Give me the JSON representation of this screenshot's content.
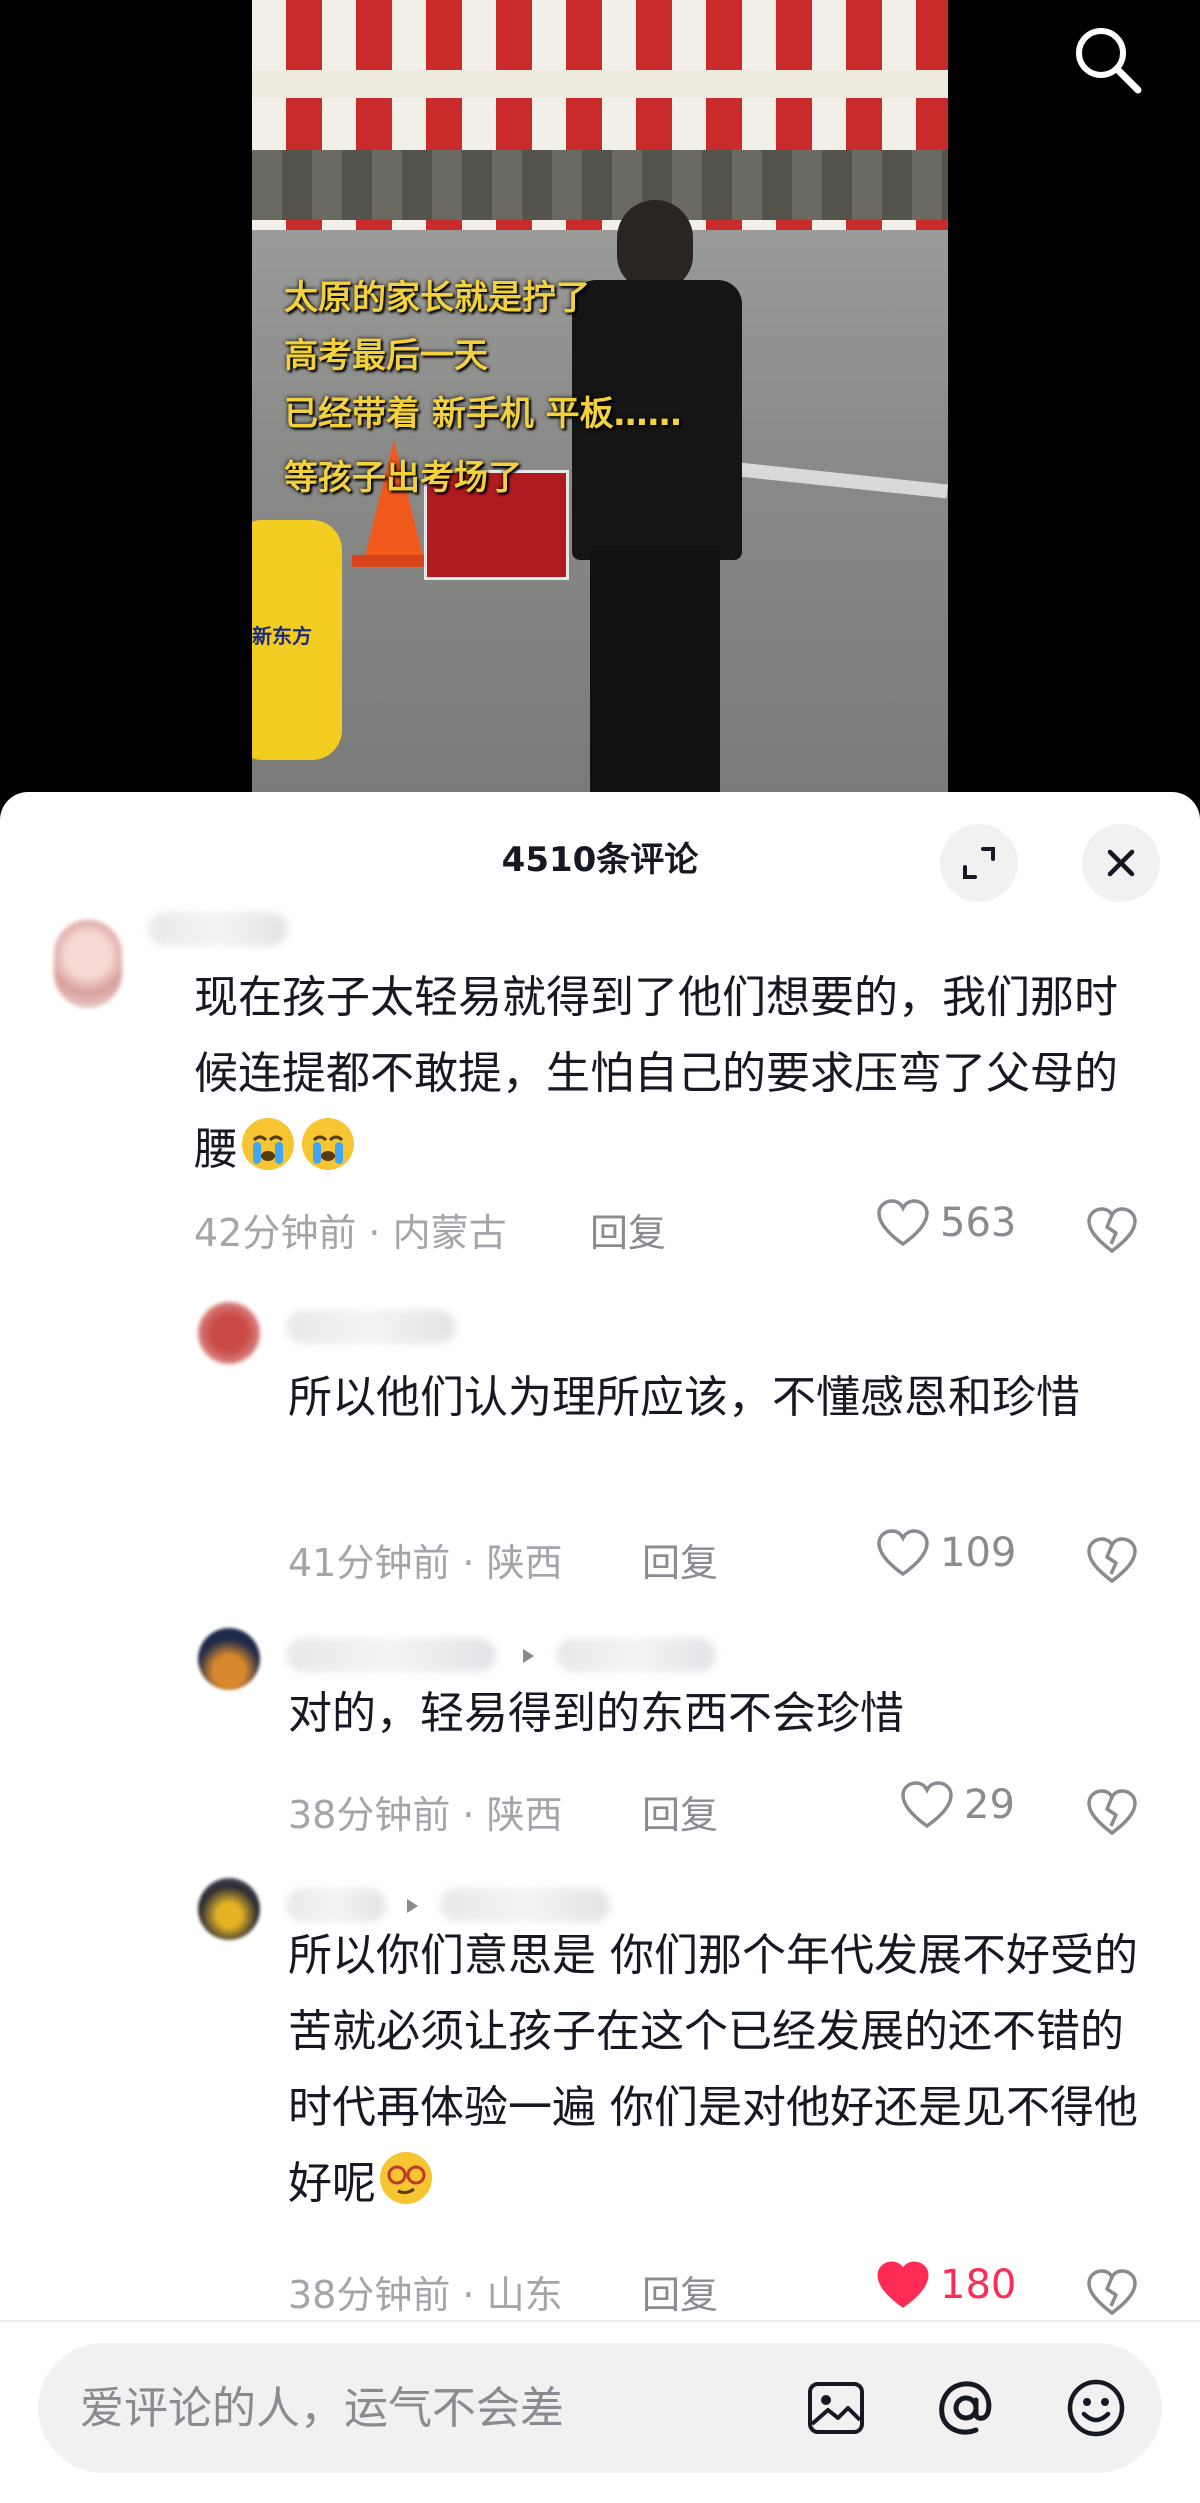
{
  "video": {
    "caption_lines": [
      "太原的家长就是拧了",
      "高考最后一天",
      "已经带着 新手机 平板……",
      "等孩子出考场了"
    ],
    "bag_text": "新东方"
  },
  "header": {
    "title": "4510条评论"
  },
  "comments": [
    {
      "text": "现在孩子太轻易就得到了他们想要的，我们那时候连提都不敢提，生怕自己的要求压弯了父母的腰",
      "time_location": "42分钟前 · 内蒙古",
      "reply_label": "回复",
      "likes": "563",
      "liked": false,
      "emoji": [
        "loudly-crying-emoji",
        "loudly-crying-emoji"
      ]
    },
    {
      "text": "所以他们认为理所应该，不懂感恩和珍惜",
      "time_location": "41分钟前 · 陕西",
      "reply_label": "回复",
      "likes": "109",
      "liked": false
    },
    {
      "text": "对的，轻易得到的东西不会珍惜",
      "time_location": "38分钟前 · 陕西",
      "reply_label": "回复",
      "likes": "29",
      "liked": false
    },
    {
      "text": "所以你们意思是  你们那个年代发展不好受的苦就必须让孩子在这个已经发展的还不错的时代再体验一遍  你们是对他好还是见不得他好呢",
      "time_location": "38分钟前 · 山东",
      "reply_label": "回复",
      "likes": "180",
      "liked": true,
      "emoji": [
        "smug-glasses-emoji"
      ]
    }
  ],
  "input": {
    "placeholder": "爱评论的人，运气不会差"
  },
  "colors": {
    "liked": "#fe2c55",
    "caption": "#f2d23c",
    "muted": "#a4a5ab"
  }
}
